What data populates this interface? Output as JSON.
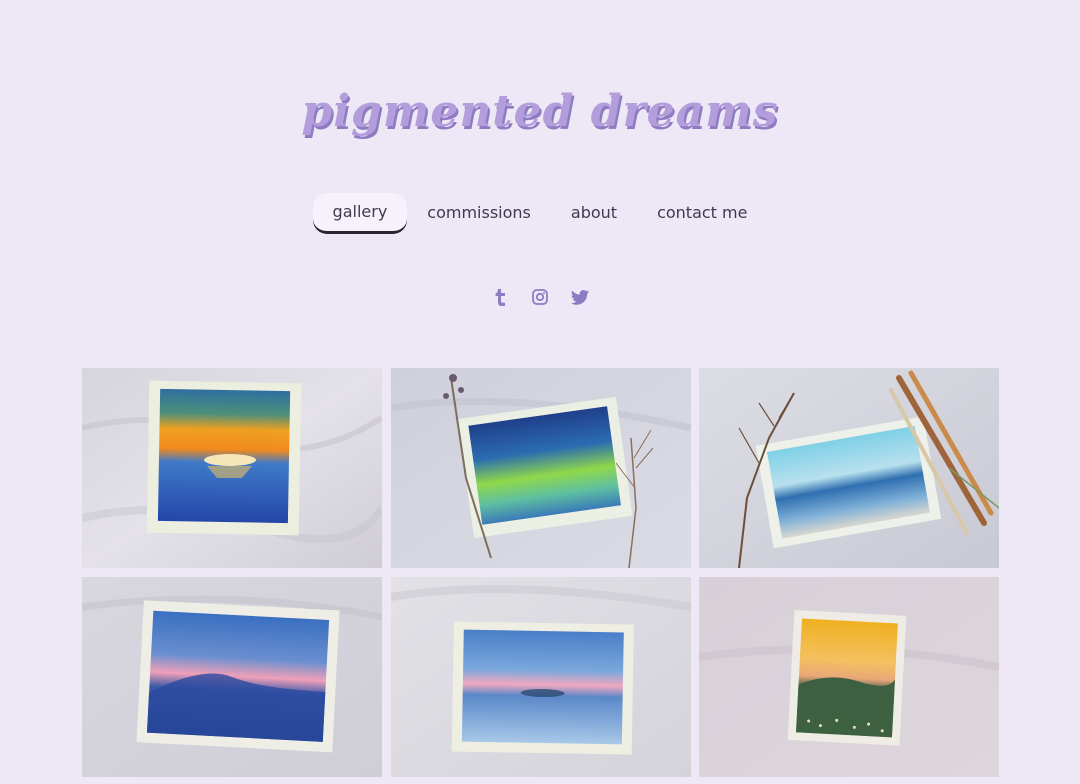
{
  "site": {
    "title": "pigmented dreams"
  },
  "nav": {
    "items": [
      {
        "label": "gallery",
        "active": true
      },
      {
        "label": "commissions",
        "active": false
      },
      {
        "label": "about",
        "active": false
      },
      {
        "label": "contact me",
        "active": false
      }
    ]
  },
  "social": {
    "icons": [
      "tumblr-icon",
      "instagram-icon",
      "twitter-icon"
    ],
    "color": "#8e7cc3"
  },
  "colors": {
    "background": "#ede7f6",
    "title": "#b39ddb",
    "title_shadow": "#8e7cc3",
    "nav_text": "#3f3a4d"
  },
  "gallery": {
    "images": [
      {
        "subject": "sunset over sea watercolor"
      },
      {
        "subject": "green aurora watercolor with dried flowers"
      },
      {
        "subject": "ocean waves watercolor with paint brushes"
      },
      {
        "subject": "pink sky over mountain watercolor"
      },
      {
        "subject": "blue clouds reflection watercolor"
      },
      {
        "subject": "golden sunset over hills watercolor"
      }
    ]
  }
}
